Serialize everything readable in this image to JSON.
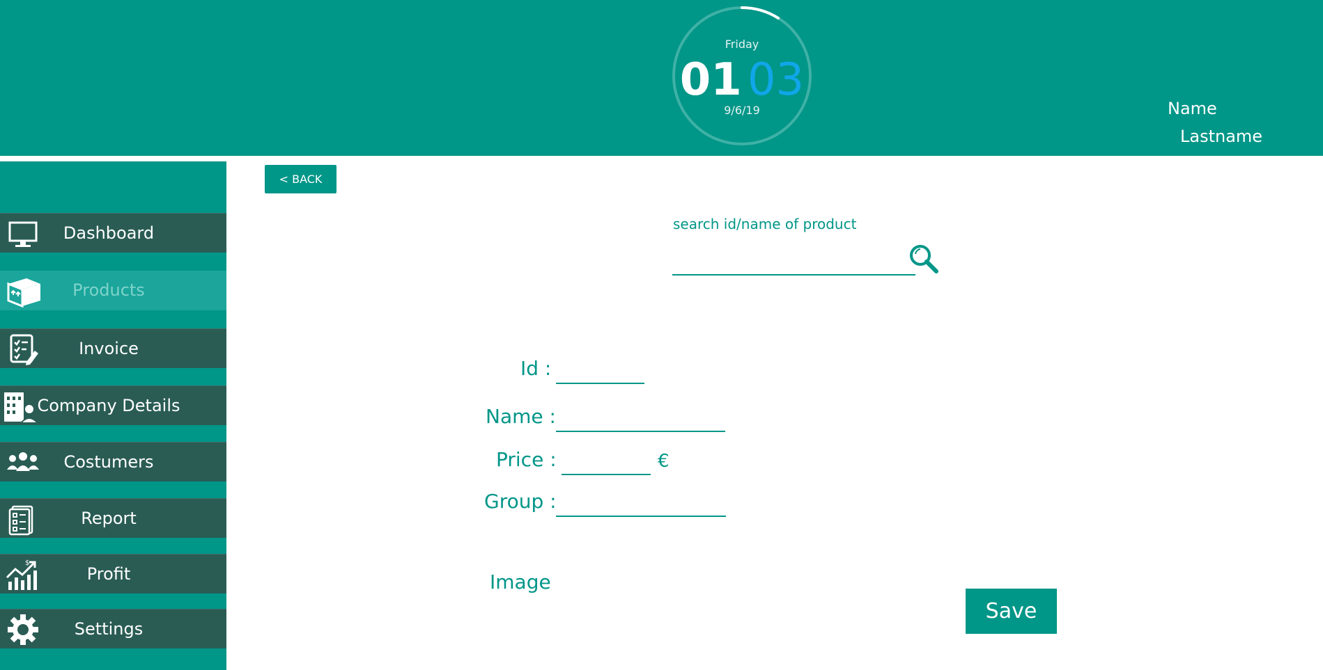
{
  "colors": {
    "accent": "#009688",
    "nav_item": "#2a5c54",
    "nav_active": "#1ba59b",
    "clock_minutes": "#10a6e8"
  },
  "header": {
    "clock": {
      "day": "Friday",
      "hours": "01",
      "minutes": "03",
      "date": "9/6/19"
    },
    "user": {
      "name": "Name",
      "lastname": "Lastname"
    }
  },
  "sidebar": {
    "active": "Products",
    "items": [
      {
        "label": "Dashboard",
        "icon": "monitor-icon"
      },
      {
        "label": "Products",
        "icon": "box-icon"
      },
      {
        "label": "Invoice",
        "icon": "checklist-icon"
      },
      {
        "label": "Company Details",
        "icon": "building-user-icon"
      },
      {
        "label": "Costumers",
        "icon": "users-icon"
      },
      {
        "label": "Report",
        "icon": "report-icon"
      },
      {
        "label": "Profit",
        "icon": "chart-up-icon"
      },
      {
        "label": "Settings",
        "icon": "gear-icon"
      }
    ]
  },
  "toolbar": {
    "back_label": "< BACK"
  },
  "search": {
    "label": "search id/name of product",
    "value": "",
    "icon": "search-icon"
  },
  "form": {
    "id_label": "Id :",
    "name_label": "Name :",
    "price_label": "Price :",
    "currency": "€",
    "group_label": "Group :",
    "image_label": "Image",
    "id_value": "",
    "name_value": "",
    "price_value": "",
    "group_value": "",
    "save_label": "Save"
  }
}
